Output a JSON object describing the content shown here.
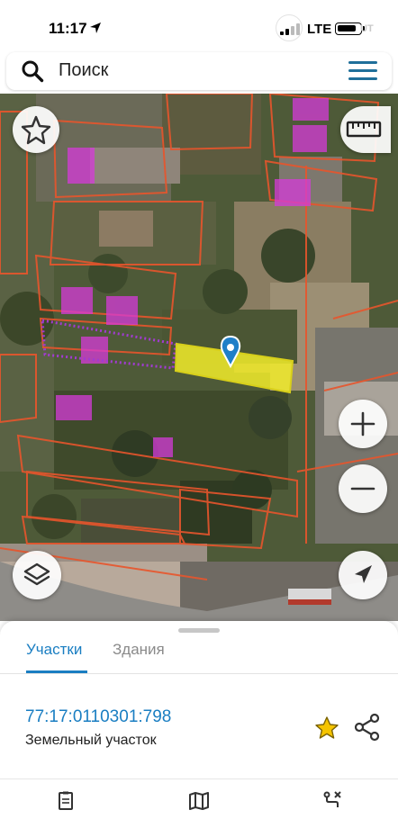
{
  "status_bar": {
    "time": "11:17",
    "network": "LTE",
    "faint_label": "UT",
    "location_icon": "location-arrow-icon",
    "battery_level": 0.85
  },
  "search": {
    "placeholder": "Поиск",
    "search_icon": "search-icon",
    "menu_icon": "hamburger-menu-icon"
  },
  "map": {
    "type": "satellite-cadastral",
    "selected_parcel_color": "#f2ec2a",
    "boundary_color": "#e8552c",
    "building_color": "#d63bd9",
    "marker_color": "#1f7fc8",
    "controls": {
      "favorites_icon": "star-outline-icon",
      "ruler_icon": "ruler-icon",
      "zoom_in_icon": "plus-icon",
      "zoom_out_icon": "minus-icon",
      "layers_icon": "layers-icon",
      "locate_icon": "navigation-arrow-icon"
    }
  },
  "sheet": {
    "tabs": [
      {
        "label": "Участки",
        "active": true
      },
      {
        "label": "Здания",
        "active": false
      }
    ],
    "parcel": {
      "cadastral_number": "77:17:0110301:798",
      "type": "Земельный участок",
      "favorite_icon": "star-filled-icon",
      "share_icon": "share-icon",
      "favorite_color": "#f5c400"
    }
  },
  "bottom_nav": {
    "items": [
      {
        "icon": "document-icon"
      },
      {
        "icon": "map-icon"
      },
      {
        "icon": "route-icon"
      }
    ]
  }
}
